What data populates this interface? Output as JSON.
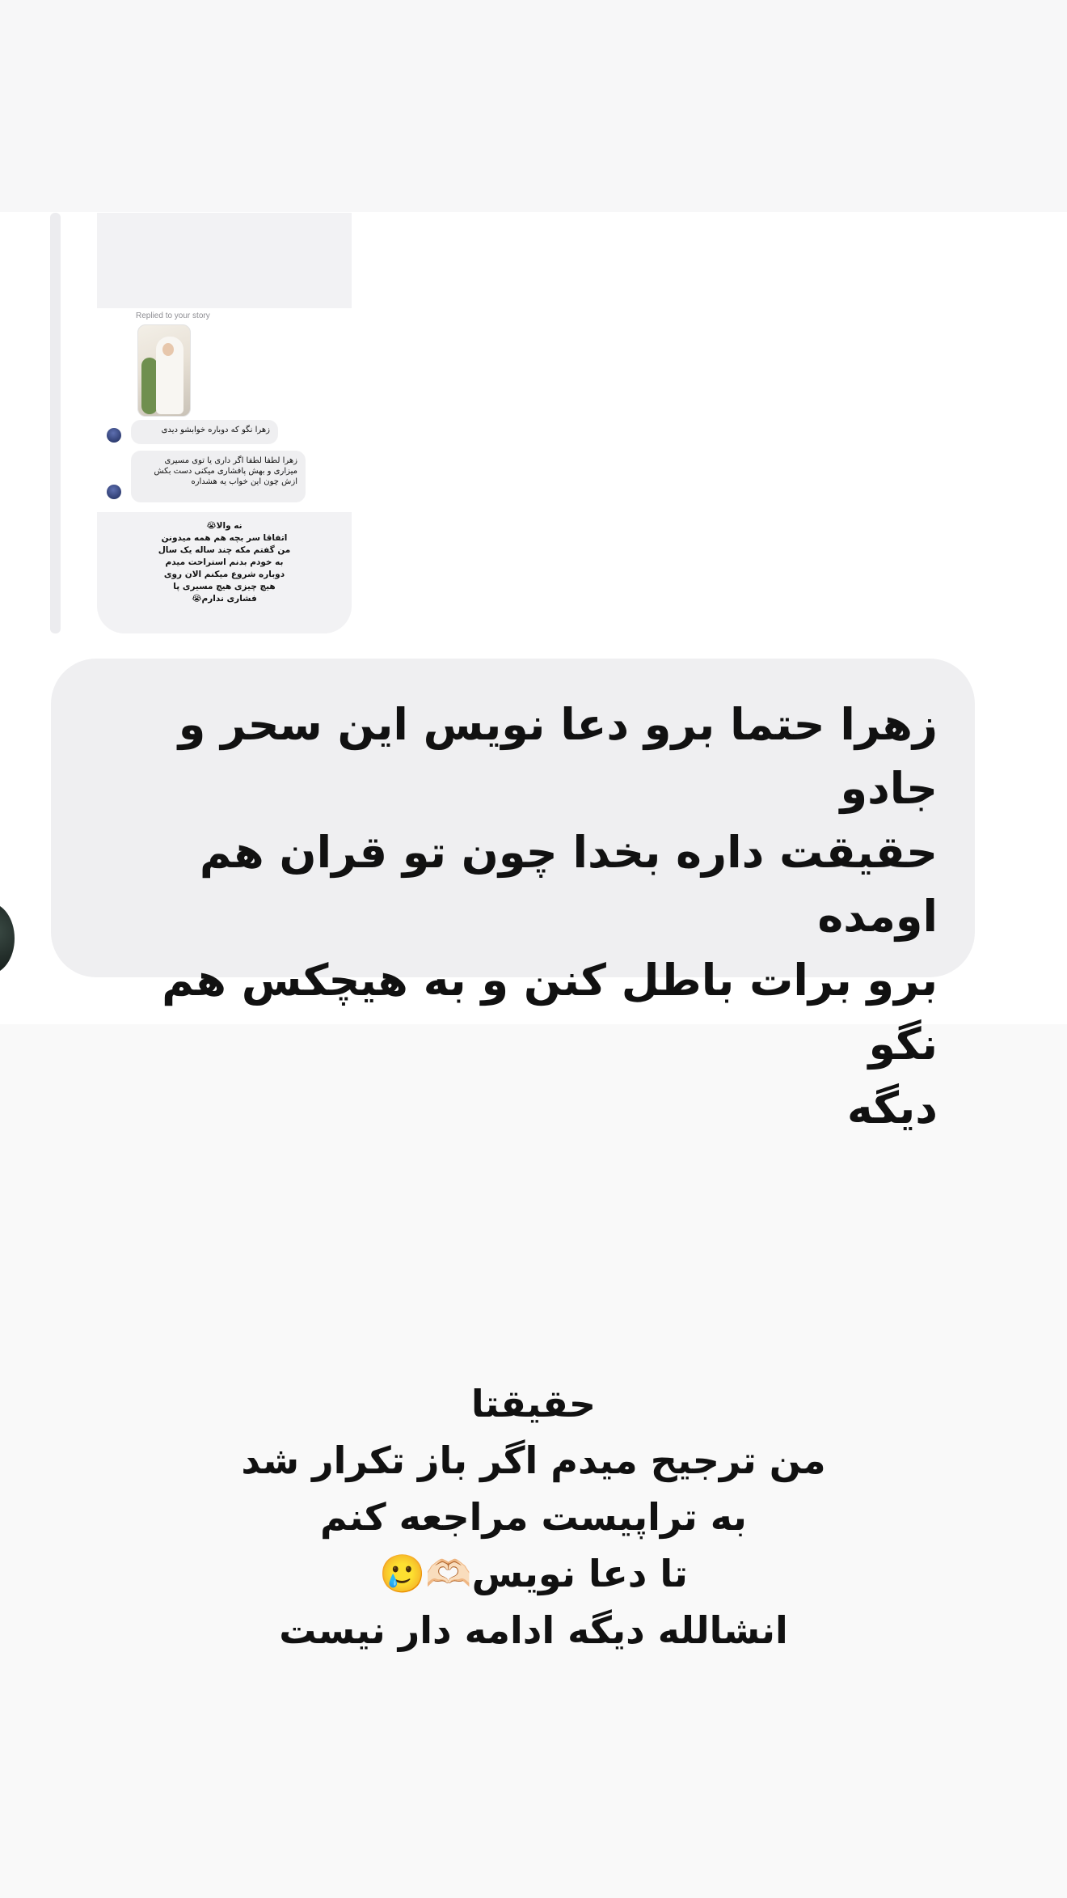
{
  "story_reply": {
    "label": "Replied to your story",
    "messages": [
      "زهرا نگو که دوباره خوابشو دیدی",
      "زهرا لطفا لطفا اگر داری یا توی مسیری میزاری و بهش پافشاری میکنی دست بکش ازش چون این خواب یه هشداره"
    ],
    "my_reply": [
      "نه والا😭",
      "اتفاقا سر بچه هم همه میدونن",
      "من گفتم مکه چند ساله یک سال",
      "به خودم بدنم استراحت میدم",
      "دوباره شروع میکنم الان روی",
      "هیچ چیزی هیچ مسیری پا",
      "فشاری ندارم😭"
    ]
  },
  "incoming_message": {
    "lines": [
      "زهرا حتما برو دعا نویس این سحر و جادو",
      "حقیقت داره بخدا چون تو قران هم اومده",
      "برو برات باطل کنن و به هیچکس هم نگو",
      "دیگه"
    ]
  },
  "caption": {
    "lines": [
      "حقیقتا",
      "من ترجیح میدم اگر باز تکرار شد",
      "به تراپیست مراجعه کنم",
      "تا دعا نویس🫶🏻🥲",
      "انشالله دیگه ادامه دار نیست"
    ]
  }
}
